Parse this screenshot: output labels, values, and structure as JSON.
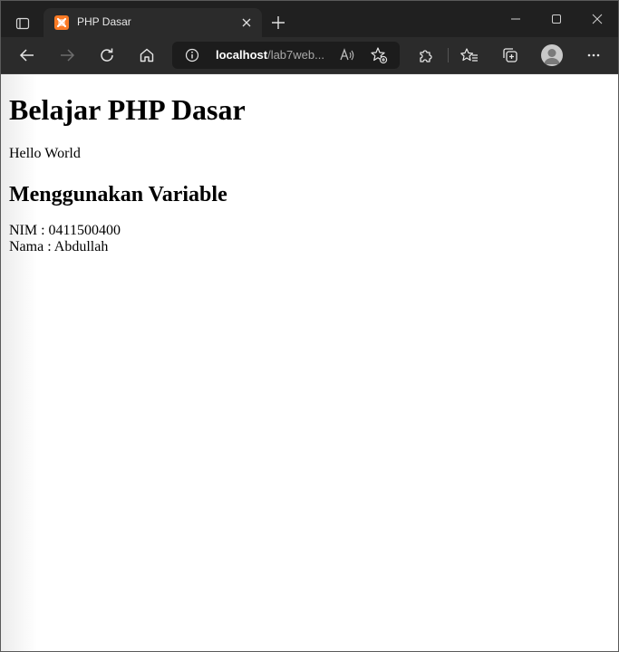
{
  "browser": {
    "tab": {
      "title": "PHP Dasar"
    },
    "address": {
      "host": "localhost",
      "path": "/lab7web..."
    }
  },
  "page": {
    "heading": "Belajar PHP Dasar",
    "hello": "Hello World",
    "subheading": "Menggunakan Variable",
    "nim_line": "NIM : 0411500400",
    "nama_line": "Nama : Abdullah"
  },
  "icons": {
    "tab_actions": "tab-actions-icon",
    "favicon": "xampp-favicon-icon",
    "close": "close-icon",
    "new_tab": "plus-icon",
    "minimize": "minimize-icon",
    "maximize": "maximize-icon",
    "window_close": "close-icon",
    "back": "back-arrow-icon",
    "forward": "forward-arrow-icon",
    "refresh": "refresh-icon",
    "home": "home-icon",
    "site_info": "info-icon",
    "read_aloud": "read-aloud-icon",
    "add_favorite": "add-favorite-icon",
    "extensions": "puzzle-icon",
    "favorites": "favorites-icon",
    "collections": "collections-icon",
    "profile": "avatar-icon",
    "more": "more-icon"
  },
  "colors": {
    "titlebar": "#202020",
    "toolbar": "#2b2b2b",
    "favicon": "#fb7a24",
    "page_bg": "#ffffff"
  }
}
